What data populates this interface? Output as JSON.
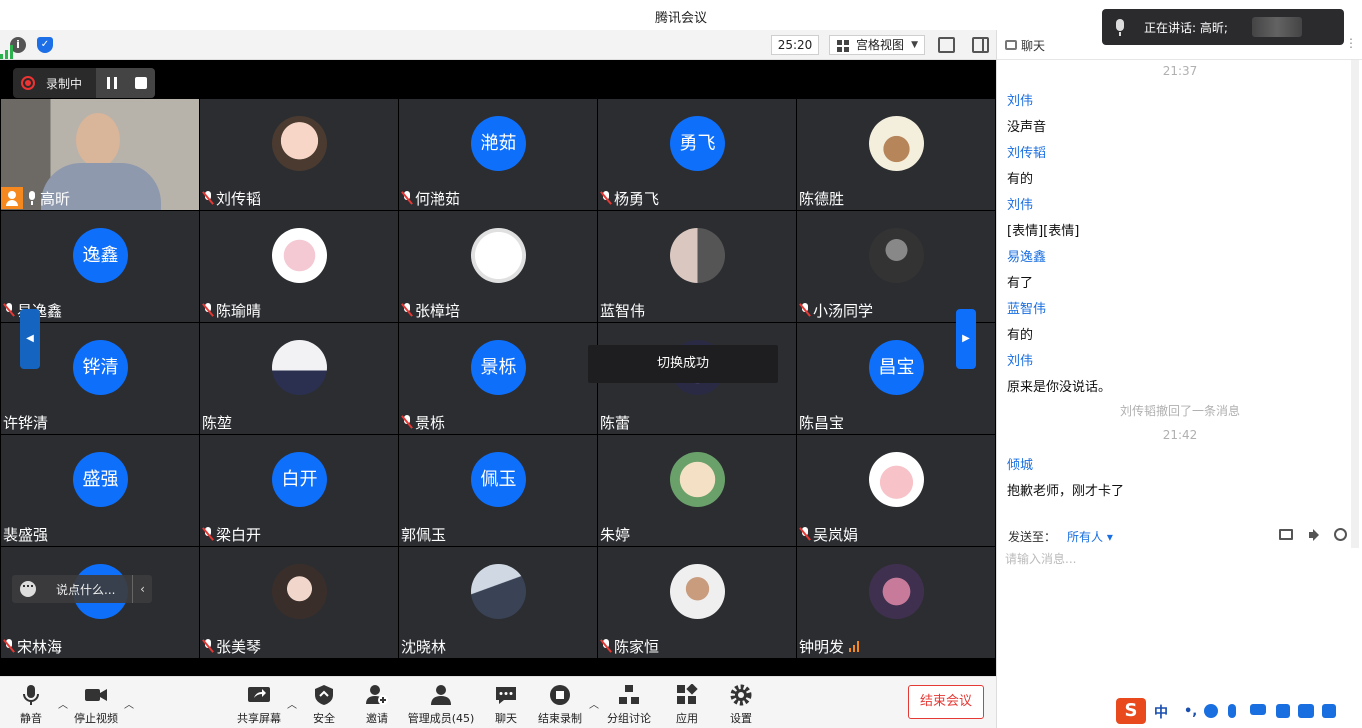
{
  "window": {
    "title": "腾讯会议"
  },
  "topbar": {
    "timer": "25:20",
    "view_mode": "宫格视图"
  },
  "recording": {
    "label": "录制中"
  },
  "tiles": [
    {
      "name": "高昕",
      "mic": "on",
      "host": true,
      "avatar_text": "",
      "avatar": "camera"
    },
    {
      "name": "刘传韬",
      "mic": "off",
      "avatar_text": "",
      "avatar": "photo-baby"
    },
    {
      "name": "何滟茹",
      "mic": "off",
      "avatar_text": "滟茹",
      "avatar": "text"
    },
    {
      "name": "杨勇飞",
      "mic": "off",
      "avatar_text": "勇飞",
      "avatar": "text"
    },
    {
      "name": "陈德胜",
      "mic": "none",
      "avatar_text": "",
      "avatar": "photo-sheep"
    },
    {
      "name": "易逸鑫",
      "mic": "off",
      "avatar_text": "逸鑫",
      "avatar": "text"
    },
    {
      "name": "陈瑜晴",
      "mic": "off",
      "avatar_text": "",
      "avatar": "photo-pig"
    },
    {
      "name": "张樟培",
      "mic": "off",
      "avatar_text": "",
      "avatar": "photo-smile"
    },
    {
      "name": "蓝智伟",
      "mic": "none",
      "avatar_text": "",
      "avatar": "photo-couple"
    },
    {
      "name": "小汤同学",
      "mic": "off",
      "avatar_text": "",
      "avatar": "photo-dark"
    },
    {
      "name": "许铧清",
      "mic": "none",
      "avatar_text": "铧清",
      "avatar": "text"
    },
    {
      "name": "陈堃",
      "mic": "none",
      "avatar_text": "",
      "avatar": "photo-night"
    },
    {
      "name": "景栎",
      "mic": "off",
      "avatar_text": "景栎",
      "avatar": "text"
    },
    {
      "name": "陈蕾",
      "mic": "none",
      "avatar_text": "",
      "avatar": "photo-purple"
    },
    {
      "name": "陈昌宝",
      "mic": "none",
      "avatar_text": "昌宝",
      "avatar": "text"
    },
    {
      "name": "裴盛强",
      "mic": "none",
      "avatar_text": "盛强",
      "avatar": "text"
    },
    {
      "name": "梁白开",
      "mic": "off",
      "avatar_text": "白开",
      "avatar": "text"
    },
    {
      "name": "郭佩玉",
      "mic": "none",
      "avatar_text": "佩玉",
      "avatar": "text"
    },
    {
      "name": "朱婷",
      "mic": "none",
      "avatar_text": "",
      "avatar": "photo-cartoon"
    },
    {
      "name": "吴岚娟",
      "mic": "off",
      "avatar_text": "",
      "avatar": "photo-pink"
    },
    {
      "name": "宋林海",
      "mic": "off",
      "avatar_text": "",
      "avatar": "text-hidden"
    },
    {
      "name": "张美琴",
      "mic": "off",
      "avatar_text": "",
      "avatar": "photo-girl"
    },
    {
      "name": "沈晓林",
      "mic": "none",
      "avatar_text": "",
      "avatar": "photo-boy"
    },
    {
      "name": "陈家恒",
      "mic": "off",
      "avatar_text": "",
      "avatar": "photo-man"
    },
    {
      "name": "钟明发",
      "mic": "none",
      "signal": true,
      "avatar_text": "",
      "avatar": "photo-anime"
    }
  ],
  "toast": "切换成功",
  "speak_hint": "说点什么...",
  "toolbar": {
    "mute": "静音",
    "video": "停止视频",
    "share": "共享屏幕",
    "security": "安全",
    "invite": "邀请",
    "members": "管理成员(45)",
    "chat": "聊天",
    "stop_record": "结束录制",
    "breakout": "分组讨论",
    "apps": "应用",
    "settings": "设置",
    "end_meeting": "结束会议"
  },
  "chat": {
    "title": "聊天",
    "speaking_label": "正在讲话: 高昕;",
    "messages": [
      {
        "kind": "time",
        "text": "21:37"
      },
      {
        "kind": "sender",
        "text": "刘伟"
      },
      {
        "kind": "content",
        "text": "没声音"
      },
      {
        "kind": "sender",
        "text": " 刘传韬"
      },
      {
        "kind": "content",
        "text": "有的"
      },
      {
        "kind": "sender",
        "text": "刘伟"
      },
      {
        "kind": "content",
        "text": "[表情][表情]"
      },
      {
        "kind": "sender",
        "text": "易逸鑫"
      },
      {
        "kind": "content",
        "text": "有了"
      },
      {
        "kind": "sender",
        "text": "蓝智伟"
      },
      {
        "kind": "content",
        "text": "有的"
      },
      {
        "kind": "sender",
        "text": "刘伟"
      },
      {
        "kind": "content",
        "text": "原来是你没说话。"
      },
      {
        "kind": "system",
        "text": "刘传韬撤回了一条消息"
      },
      {
        "kind": "time",
        "text": "21:42"
      },
      {
        "kind": "sender",
        "text": "倾城"
      },
      {
        "kind": "content",
        "text": "抱歉老师，刚才卡了"
      }
    ],
    "send_to_label": "发送至：",
    "send_to_value": "所有人",
    "input_placeholder": "请输入消息..."
  },
  "ime": {
    "mode": "中"
  },
  "colors": {
    "accent": "#0e6ffa",
    "end": "#e53935",
    "tile": "#2b2d31",
    "host": "#f5891f"
  }
}
